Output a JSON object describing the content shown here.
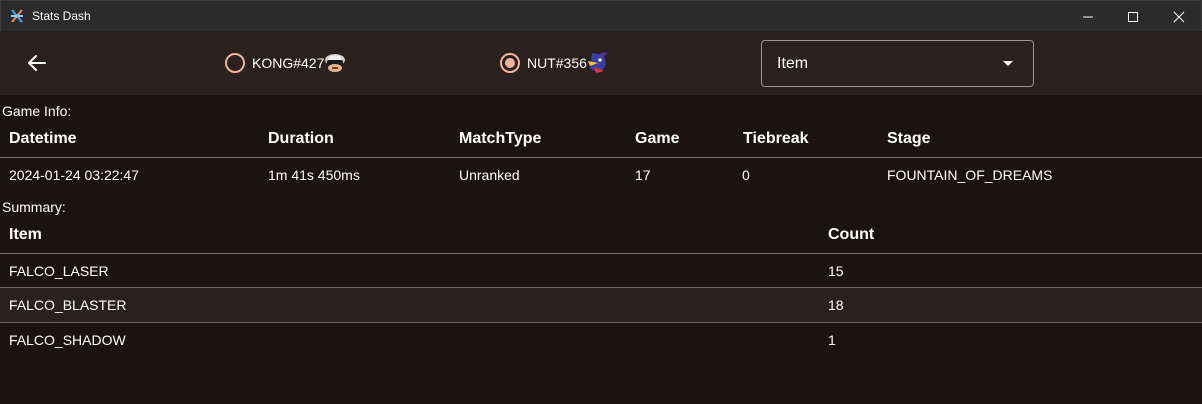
{
  "window": {
    "title": "Stats Dash",
    "icon": "app-logo-icon"
  },
  "topbar": {
    "back_icon": "arrow-left-icon",
    "players": [
      {
        "tag": "KONG#427",
        "selected": false,
        "icon": "donkey-kong-character-icon"
      },
      {
        "tag": "NUT#356",
        "selected": true,
        "icon": "falco-character-icon"
      }
    ],
    "select": {
      "value": "Item",
      "icon": "caret-down-icon"
    }
  },
  "game_info": {
    "label": "Game Info:",
    "headers": [
      "Datetime",
      "Duration",
      "MatchType",
      "Game",
      "Tiebreak",
      "Stage"
    ],
    "row": [
      "2024-01-24 03:22:47",
      "1m 41s 450ms",
      "Unranked",
      "17",
      "0",
      "FOUNTAIN_OF_DREAMS"
    ]
  },
  "summary": {
    "label": "Summary:",
    "headers": [
      "Item",
      "Count"
    ],
    "rows": [
      {
        "item": "FALCO_LASER",
        "count": "15",
        "highlighted": false
      },
      {
        "item": "FALCO_BLASTER",
        "count": "18",
        "highlighted": true
      },
      {
        "item": "FALCO_SHADOW",
        "count": "1",
        "highlighted": false
      }
    ]
  },
  "colors": {
    "background": "#1a1311",
    "topbar": "#2a201d",
    "titlebar": "#2b2b2b",
    "accent": "#f2b39e",
    "highlight_row": "#2a201d"
  }
}
